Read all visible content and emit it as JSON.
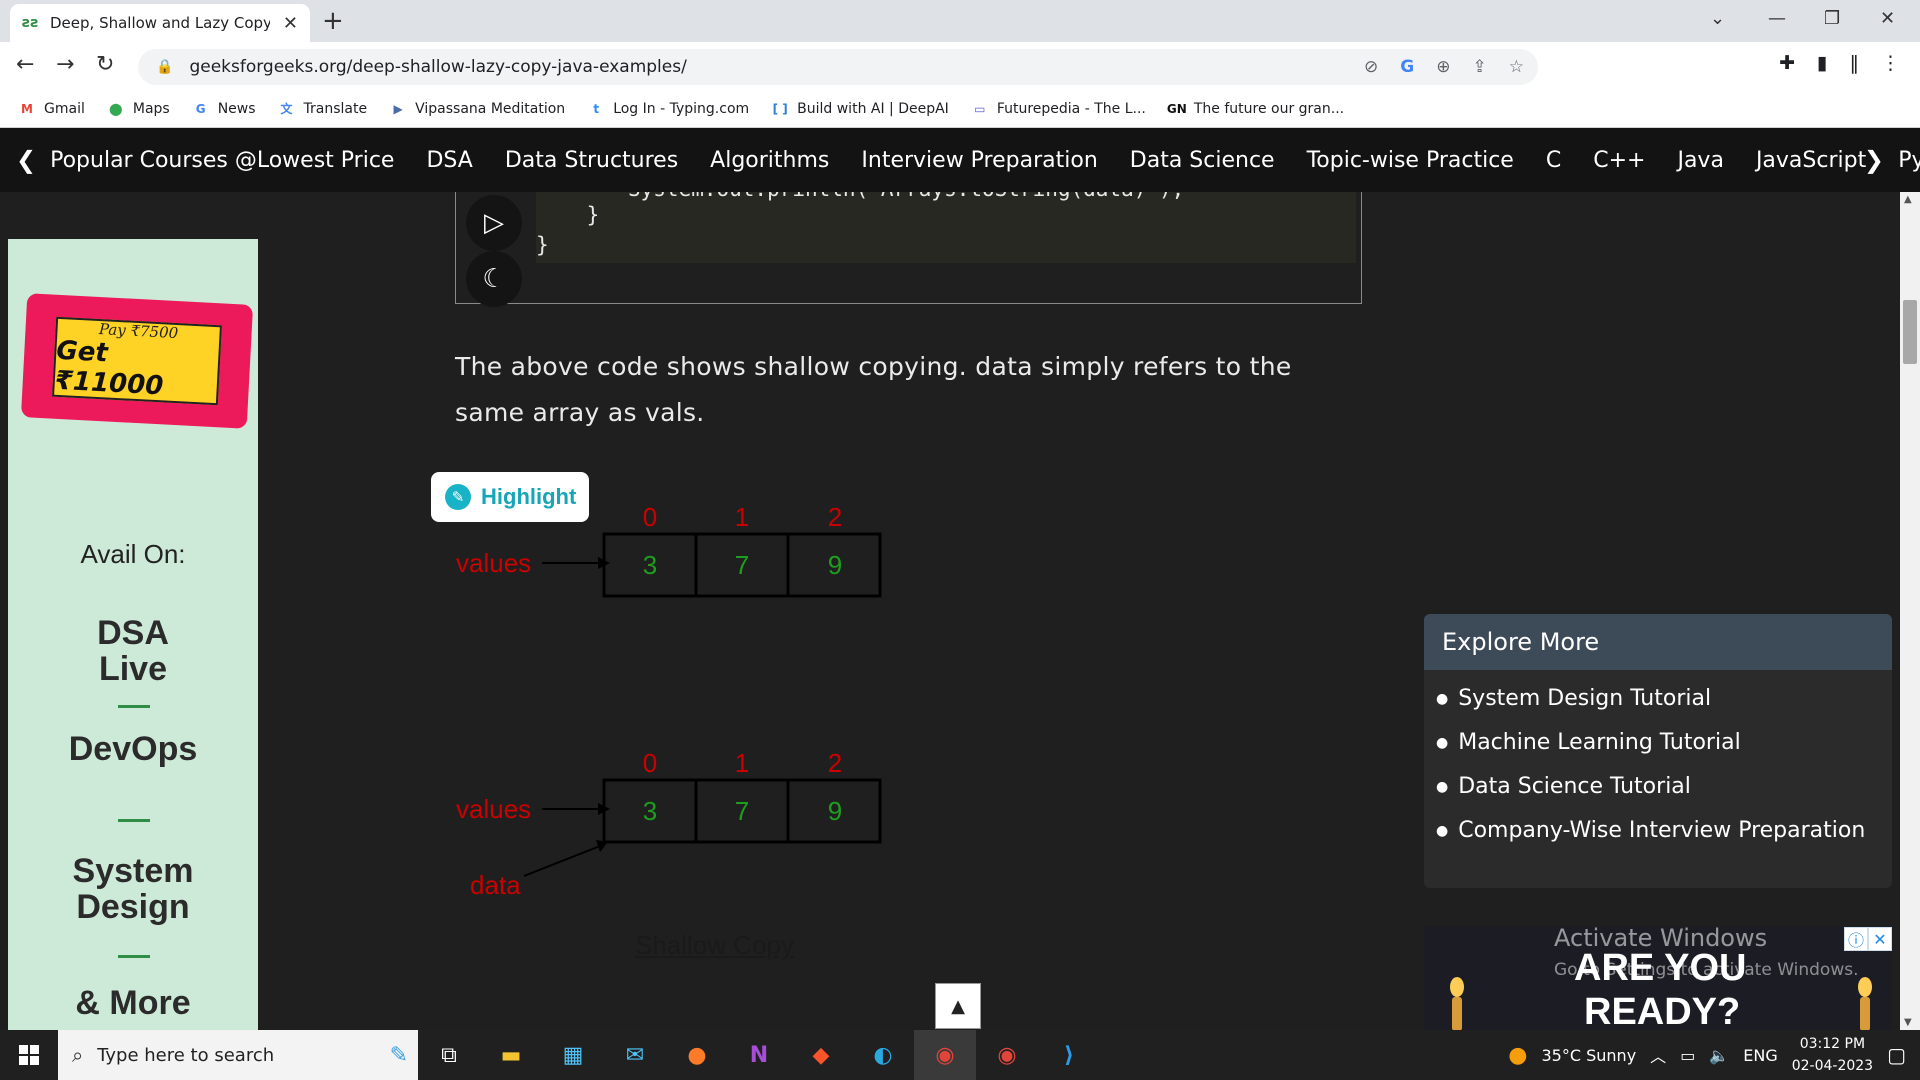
{
  "browser": {
    "tab_title": "Deep, Shallow and Lazy Copy wi",
    "url": "geeksforgeeks.org/deep-shallow-lazy-copy-java-examples/",
    "bookmarks": [
      {
        "label": "Gmail",
        "icon": "gmail-icon",
        "color": "#ea4335",
        "glyph": "M"
      },
      {
        "label": "Maps",
        "icon": "maps-icon",
        "color": "#34a853",
        "glyph": "⬤"
      },
      {
        "label": "News",
        "icon": "news-icon",
        "color": "#4285f4",
        "glyph": "G"
      },
      {
        "label": "Translate",
        "icon": "translate-icon",
        "color": "#4285f4",
        "glyph": "文"
      },
      {
        "label": "Vipassana Meditation",
        "icon": "vipassana-icon",
        "color": "#4a6da7",
        "glyph": "▶"
      },
      {
        "label": "Log In - Typing.com",
        "icon": "typing-icon",
        "color": "#2d8cff",
        "glyph": "t"
      },
      {
        "label": "Build with AI | DeepAI",
        "icon": "deepai-icon",
        "color": "#2a7de1",
        "glyph": "[ ]"
      },
      {
        "label": "Futurepedia - The L...",
        "icon": "futurepedia-icon",
        "color": "#5a6acf",
        "glyph": "▭"
      },
      {
        "label": "The future our gran...",
        "icon": "gn-icon",
        "color": "#111111",
        "glyph": "GN"
      }
    ]
  },
  "gfg_nav": {
    "items": [
      "Popular Courses @Lowest Price",
      "DSA",
      "Data Structures",
      "Algorithms",
      "Interview Preparation",
      "Data Science",
      "Topic-wise Practice",
      "C",
      "C++",
      "Java",
      "JavaScript",
      "Pyth"
    ]
  },
  "left_ad": {
    "pay": "Pay ₹7500",
    "get": "Get ₹11000",
    "avail": "Avail On:",
    "items": [
      "DSA\nLive",
      "DevOps",
      "System\nDesign",
      "& More"
    ]
  },
  "code": {
    "lines": [
      "System.out.println(\"Arrays.toString(data)\");",
      "    }",
      "}"
    ]
  },
  "article": {
    "paragraph": "The above code shows shallow copying. data simply refers to the same array as vals."
  },
  "highlight": {
    "label": "Highlight"
  },
  "diagram": {
    "indices": [
      "0",
      "1",
      "2"
    ],
    "values": [
      "3",
      "7",
      "9"
    ],
    "pointer_label": "values",
    "second_pointer": "data",
    "caption": "Shallow Copy"
  },
  "explore": {
    "title": "Explore More",
    "items": [
      "System Design Tutorial",
      "Machine Learning Tutorial",
      "Data Science Tutorial",
      "Company-Wise Interview Preparation"
    ]
  },
  "right_ad": {
    "line1": "ARE YOU",
    "line2": "READY?"
  },
  "watermark": {
    "title": "Activate Windows",
    "subtitle": "Go to Settings to activate Windows."
  },
  "taskbar": {
    "search_placeholder": "Type here to search",
    "weather": "35°C  Sunny",
    "lang": "ENG",
    "time": "03:12 PM",
    "date": "02-04-2023"
  },
  "colors": {
    "gfg_green": "#2f8d46",
    "diagram_red": "#cc0000",
    "diagram_green": "#1e9e1e",
    "explore_header": "#3d4a58",
    "ad_pink": "#ec1a5b",
    "ad_yellow": "#ffd226"
  }
}
